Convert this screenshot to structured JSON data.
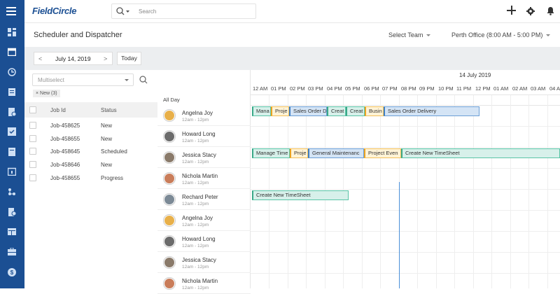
{
  "app": {
    "logo": "FieldCircle"
  },
  "search": {
    "placeholder": "Search"
  },
  "header": {
    "title": "Scheduler and Dispatcher",
    "team_select": "Select Team",
    "office_select": "Perth Office (8:00 AM - 5:00 PM)"
  },
  "toolbar": {
    "date": "July 14, 2019",
    "prev": "<",
    "next": ">",
    "today": "Today"
  },
  "filters": {
    "multiselect_placeholder": "Multiselect",
    "chip": "New (3)"
  },
  "jobs": {
    "col_id": "Job Id",
    "col_status": "Status",
    "rows": [
      {
        "id": "Job-458625",
        "status": "New"
      },
      {
        "id": "Job-458655",
        "status": "New"
      },
      {
        "id": "Job-458645",
        "status": "Scheduled"
      },
      {
        "id": "Job-458646",
        "status": "New"
      },
      {
        "id": "Job-458655",
        "status": "Progress"
      }
    ]
  },
  "scheduler": {
    "date_label": "14 July 2019",
    "all_day": "All Day",
    "hours": [
      "12 AM",
      "01 PM",
      "02 PM",
      "03 PM",
      "04 PM",
      "05 PM",
      "06 PM",
      "07 PM",
      "08 PM",
      "09 PM",
      "10 PM",
      "11 PM",
      "12 PM",
      "01 AM",
      "02 AM",
      "03 AM",
      "04 A"
    ],
    "resources": [
      {
        "name": "Angelna Joy",
        "time": "12am - 12pm"
      },
      {
        "name": "Howard Long",
        "time": "12am - 12pm"
      },
      {
        "name": "Jessica Stacy",
        "time": "12am - 12pm"
      },
      {
        "name": "Nichola Martin",
        "time": "12am - 12pm"
      },
      {
        "name": "Rechard Peter",
        "time": "12am - 12pm"
      },
      {
        "name": "Angelna Joy",
        "time": "12am - 12pm"
      },
      {
        "name": "Howard Long",
        "time": "12am - 12pm"
      },
      {
        "name": "Jessica Stacy",
        "time": "12am - 12pm"
      },
      {
        "name": "Nichola Martin",
        "time": "12am - 12pm"
      }
    ],
    "events_row1": [
      "Mana",
      "Proje",
      "Sales Order D",
      "Creat",
      "Creat",
      "Busin",
      "Sales Order Delivery"
    ],
    "events_row3": [
      "Manage Time",
      "Proje",
      "General Maintenanc",
      "Project Even",
      "Create New TimeSheet"
    ],
    "events_row5": [
      "Create New TimeSheet"
    ]
  },
  "colors": {
    "brand": "#1b4f93",
    "event_green": "#59c4a6",
    "event_yellow": "#f2c05a",
    "event_blue": "#6c9fd6",
    "now_line": "#4a8fd8"
  }
}
